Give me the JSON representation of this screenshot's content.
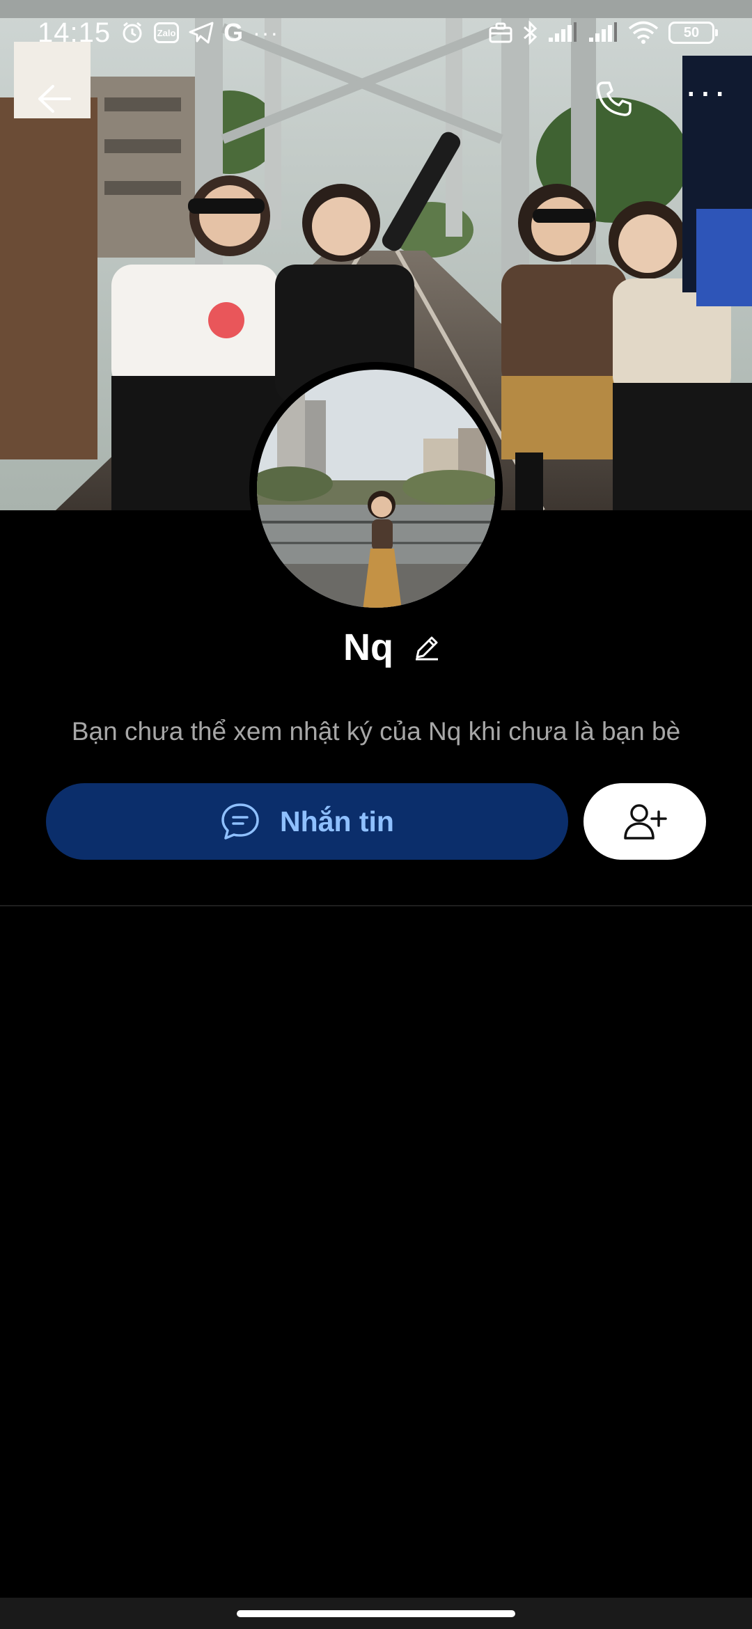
{
  "status_bar": {
    "time": "14:15",
    "zalo_label": "Zalo",
    "g_label": "G",
    "more_indicator": "···",
    "battery_level": "50"
  },
  "nav": {
    "back_icon": "arrow-left-icon",
    "call_icon": "phone-icon",
    "more_icon": "more-horizontal-icon",
    "more_label": "···"
  },
  "profile": {
    "name": "Nq",
    "edit_icon": "pencil-icon",
    "notice": "Bạn chưa thể xem nhật ký của Nq khi chưa là bạn bè"
  },
  "actions": {
    "message_label": "Nhắn tin",
    "message_icon": "chat-bubble-icon",
    "add_friend_icon": "add-user-icon"
  },
  "colors": {
    "background": "#000000",
    "message_button_bg": "#0b2e6b",
    "message_button_text": "#8fc0ff",
    "notice_text": "#a7a7a7",
    "add_friend_bg": "#ffffff"
  }
}
